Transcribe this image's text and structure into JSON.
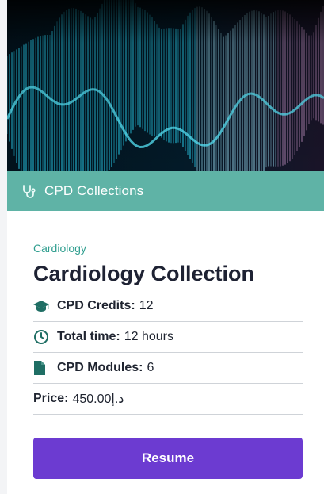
{
  "banner": {
    "icon": "stethoscope-icon",
    "label": "CPD Collections",
    "color": "#5fb3a6"
  },
  "course": {
    "category": "Cardiology",
    "title": "Cardiology Collection",
    "credits": {
      "icon": "graduation-cap-icon",
      "label": "CPD Credits:",
      "value": "12"
    },
    "time": {
      "icon": "clock-icon",
      "label": "Total time:",
      "value": "12 hours"
    },
    "modules": {
      "icon": "document-icon",
      "label": "CPD Modules:",
      "value": "6"
    },
    "price": {
      "label": "Price:",
      "value": "450.00د.إ"
    }
  },
  "actions": {
    "resume_label": "Resume",
    "accent": "#6c3bd1"
  },
  "colors": {
    "category_text": "#2f9e8f",
    "icon_teal": "#1f6e64"
  }
}
